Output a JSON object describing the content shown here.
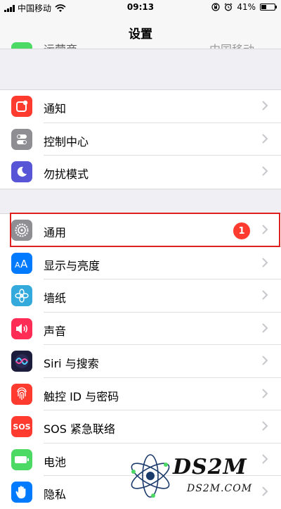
{
  "status_bar": {
    "carrier": "中国移动",
    "time": "09:13",
    "battery": "41%",
    "battery_level": 0.41
  },
  "nav": {
    "title": "设置"
  },
  "peek_row": {
    "label": "运营商",
    "value": "中国移动"
  },
  "groups": [
    [
      {
        "label": "通知",
        "icon": "notifications-icon",
        "color": "#ff3b30"
      },
      {
        "label": "控制中心",
        "icon": "control-center-icon",
        "color": "#8e8e93"
      },
      {
        "label": "勿扰模式",
        "icon": "moon-icon",
        "color": "#5856d6"
      }
    ],
    [
      {
        "label": "通用",
        "icon": "gear-icon",
        "color": "#8e8e93",
        "badge": "1",
        "highlighted": true
      },
      {
        "label": "显示与亮度",
        "icon": "display-brightness-icon",
        "color": "#007aff"
      },
      {
        "label": "墙纸",
        "icon": "wallpaper-flower-icon",
        "color": "#34aadc"
      },
      {
        "label": "声音",
        "icon": "speaker-icon",
        "color": "#ff2d55"
      },
      {
        "label": "Siri 与搜索",
        "icon": "siri-icon",
        "color": "#1c1c3c"
      },
      {
        "label": "触控 ID 与密码",
        "icon": "fingerprint-icon",
        "color": "#ff3b30"
      },
      {
        "label": "SOS 紧急联络",
        "icon": "sos-icon",
        "color": "#ff3b30",
        "icon_text": "SOS"
      },
      {
        "label": "电池",
        "icon": "battery-icon",
        "color": "#4cd964"
      },
      {
        "label": "隐私",
        "icon": "hand-icon",
        "color": "#007aff"
      }
    ]
  ],
  "watermark": {
    "title": "DS2M",
    "subtitle": "DS2M.COM"
  }
}
